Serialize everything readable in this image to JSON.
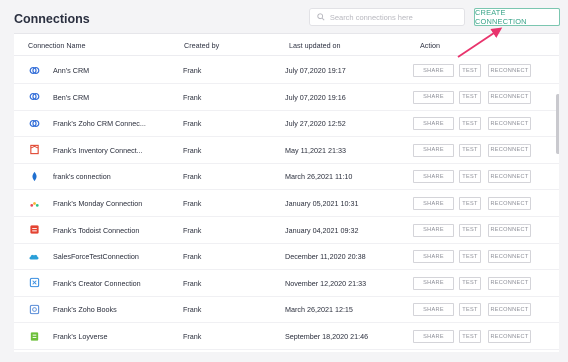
{
  "header": {
    "title": "Connections",
    "search_placeholder": "Search connections here",
    "create_label": "CREATE CONNECTION"
  },
  "columns": [
    "Connection Name",
    "Created by",
    "Last updated on",
    "Action"
  ],
  "actions": {
    "share": "SHARE",
    "test": "TEST",
    "reconnect": "RECONNECT"
  },
  "colors": {
    "accent": "#3aa58a",
    "arrow": "#e8336c"
  },
  "rows": [
    {
      "icon": "crm-icon",
      "name": "Ann's CRM",
      "created_by": "Frank",
      "updated": "July 07,2020 19:17"
    },
    {
      "icon": "crm-icon",
      "name": "Ben's CRM",
      "created_by": "Frank",
      "updated": "July 07,2020 19:16"
    },
    {
      "icon": "crm-icon",
      "name": "Frank's Zoho CRM Connec...",
      "created_by": "Frank",
      "updated": "July 27,2020 12:52"
    },
    {
      "icon": "inventory-icon",
      "name": "Frank's Inventory Connect...",
      "created_by": "Frank",
      "updated": "May 11,2021 21:33"
    },
    {
      "icon": "drop-icon",
      "name": "frank's connection",
      "created_by": "Frank",
      "updated": "March 26,2021 11:10"
    },
    {
      "icon": "monday-icon",
      "name": "Frank's Monday Connection",
      "created_by": "Frank",
      "updated": "January 05,2021 10:31"
    },
    {
      "icon": "todoist-icon",
      "name": "Frank's Todoist Connection",
      "created_by": "Frank",
      "updated": "January 04,2021 09:32"
    },
    {
      "icon": "cloud-icon",
      "name": "SalesForceTestConnection",
      "created_by": "Frank",
      "updated": "December 11,2020 20:38"
    },
    {
      "icon": "creator-icon",
      "name": "Frank's Creator Connection",
      "created_by": "Frank",
      "updated": "November 12,2020 21:33"
    },
    {
      "icon": "books-icon",
      "name": "Frank's Zoho Books",
      "created_by": "Frank",
      "updated": "March 26,2021 12:15"
    },
    {
      "icon": "loyverse-icon",
      "name": "Frank's Loyverse",
      "created_by": "Frank",
      "updated": "September 18,2020 21:46"
    }
  ]
}
